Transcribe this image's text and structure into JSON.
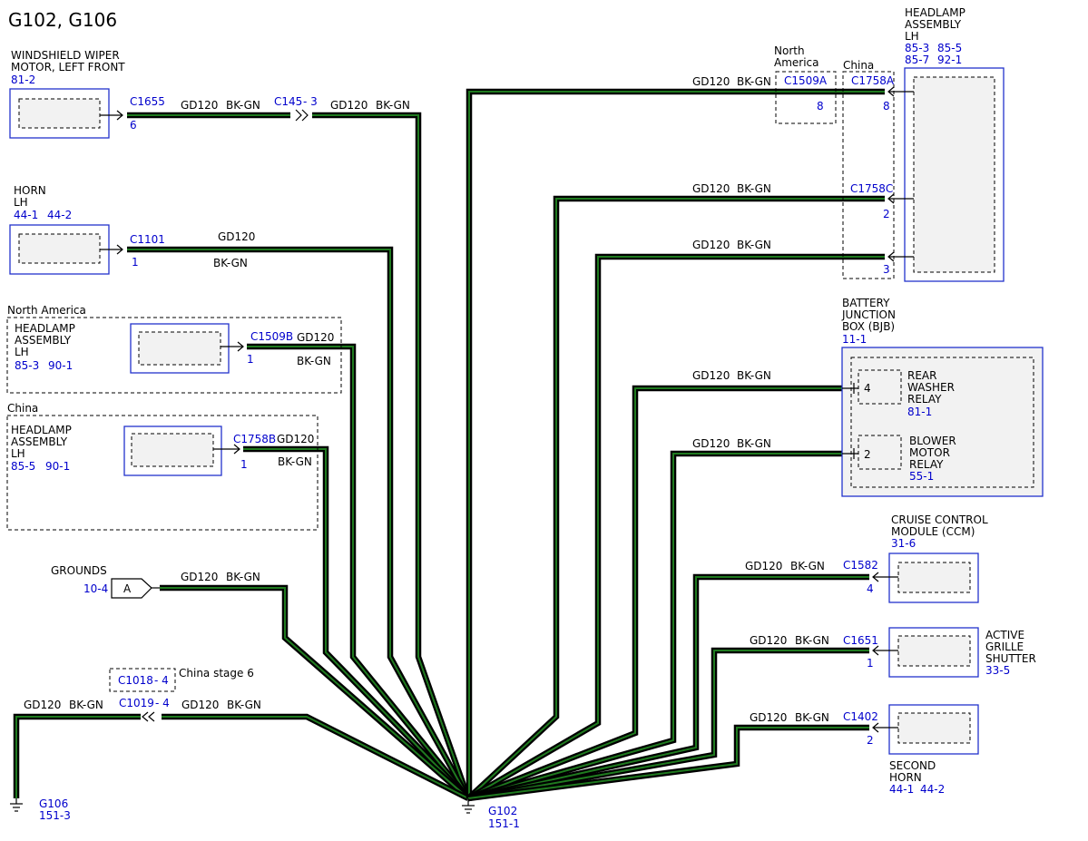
{
  "title": "G102, G106",
  "wire": {
    "circuit": "GD120",
    "color": "BK-GN"
  },
  "regions": {
    "north_america": "North America",
    "china": "China",
    "china_stage6": "China stage 6"
  },
  "left": {
    "wiper": {
      "name1": "WINDSHIELD WIPER",
      "name2": "MOTOR, LEFT FRONT",
      "ref": "81-2",
      "connector": "C1655",
      "pin": "6",
      "inline": "C145",
      "inline_pin": "- 3"
    },
    "horn": {
      "name1": "HORN",
      "name2": "LH",
      "ref1": "44-1",
      "ref2": "44-2",
      "connector": "C1101",
      "pin": "1"
    },
    "headlamp_na": {
      "name1": "HEADLAMP",
      "name2": "ASSEMBLY",
      "name3": "LH",
      "ref1": "85-3",
      "ref2": "90-1",
      "connector": "C1509B",
      "pin": "1"
    },
    "headlamp_cn": {
      "name1": "HEADLAMP",
      "name2": "ASSEMBLY",
      "name3": "LH",
      "ref1": "85-5",
      "ref2": "90-1",
      "connector": "C1758B",
      "pin": "1"
    },
    "grounds": {
      "label": "GROUNDS",
      "ref": "10-4",
      "tag": "A"
    },
    "inline": {
      "c1018": "C1018",
      "c1018_pin": "- 4",
      "c1019": "C1019",
      "c1019_pin": "- 4"
    },
    "g106": {
      "name": "G106",
      "ref": "151-3"
    }
  },
  "g102": {
    "name": "G102",
    "ref": "151-1"
  },
  "right": {
    "headlamp": {
      "name1": "HEADLAMP",
      "name2": "ASSEMBLY",
      "name3": "LH",
      "ref1": "85-3",
      "ref2": "85-5",
      "ref3": "85-7",
      "ref4": "92-1",
      "na_conn": "C1509A",
      "na_pin": "8",
      "cn_conn": "C1758A",
      "cn_pin": "8",
      "conn_c": "C1758C",
      "pin_c2": "2",
      "pin_c3": "3"
    },
    "bjb": {
      "name1": "BATTERY",
      "name2": "JUNCTION",
      "name3": "BOX (BJB)",
      "ref": "11-1",
      "relay1_pin": "4",
      "relay1_a": "REAR",
      "relay1_b": "WASHER",
      "relay1_c": "RELAY",
      "relay1_ref": "81-1",
      "relay2_pin": "2",
      "relay2_a": "BLOWER",
      "relay2_b": "MOTOR",
      "relay2_c": "RELAY",
      "relay2_ref": "55-1"
    },
    "ccm": {
      "name1": "CRUISE CONTROL",
      "name2": "MODULE (CCM)",
      "ref": "31-6",
      "connector": "C1582",
      "pin": "4"
    },
    "grille": {
      "name1": "ACTIVE",
      "name2": "GRILLE",
      "name3": "SHUTTER",
      "ref": "33-5",
      "connector": "C1651",
      "pin": "1"
    },
    "horn2": {
      "name1": "SECOND",
      "name2": "HORN",
      "ref1": "44-1",
      "ref2": "44-2",
      "connector": "C1402",
      "pin": "2"
    }
  }
}
